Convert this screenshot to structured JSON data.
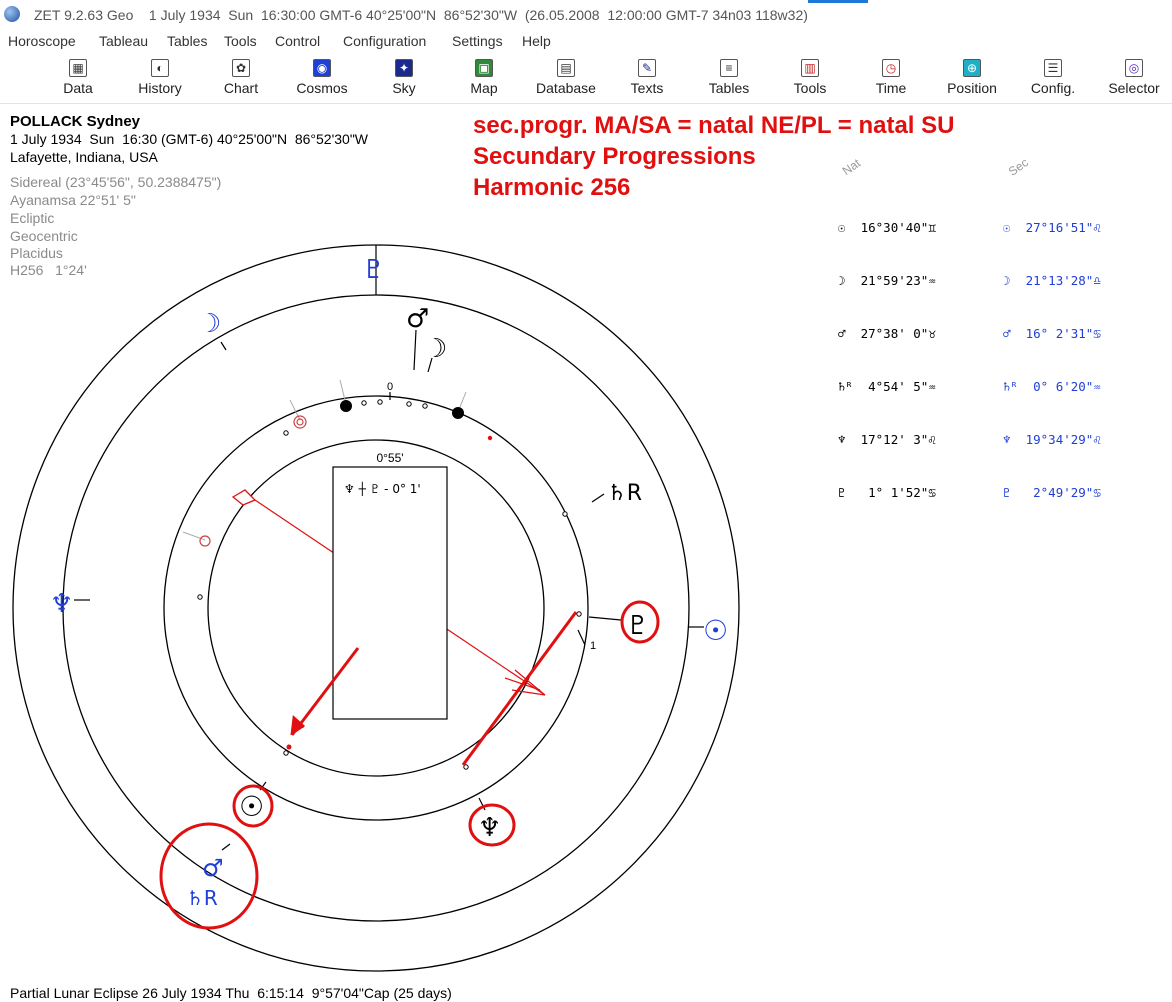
{
  "window": {
    "title": "ZET 9.2.63 Geo    1 July 1934  Sun  16:30:00 GMT-6 40°25'00\"N  86°52'30\"W  (26.05.2008  12:00:00 GMT-7 34n03 118w32)"
  },
  "menu": [
    "Horoscope",
    "Tableau",
    "Tables",
    "Tools",
    "Control",
    "Configuration",
    "Settings",
    "Help"
  ],
  "toolbar": [
    {
      "label": "Data",
      "icon": "data-icon",
      "glyph": "▦"
    },
    {
      "label": "History",
      "icon": "history-icon",
      "glyph": "◐"
    },
    {
      "label": "Chart",
      "icon": "chart-icon",
      "glyph": "✿"
    },
    {
      "label": "Cosmos",
      "icon": "cosmos-icon",
      "glyph": "◉"
    },
    {
      "label": "Sky",
      "icon": "sky-icon",
      "glyph": "✦"
    },
    {
      "label": "Map",
      "icon": "map-icon",
      "glyph": "▣"
    },
    {
      "label": "Database",
      "icon": "database-icon",
      "glyph": "▤"
    },
    {
      "label": "Texts",
      "icon": "texts-icon",
      "glyph": "✎"
    },
    {
      "label": "Tables",
      "icon": "tables-icon",
      "glyph": "≡"
    },
    {
      "label": "Tools",
      "icon": "tools-icon",
      "glyph": "▥"
    },
    {
      "label": "Time",
      "icon": "time-icon",
      "glyph": "◷"
    },
    {
      "label": "Position",
      "icon": "position-icon",
      "glyph": "⊕"
    },
    {
      "label": "Config.",
      "icon": "config-icon",
      "glyph": "☰"
    },
    {
      "label": "Selector",
      "icon": "selector-icon",
      "glyph": "◎"
    }
  ],
  "person": {
    "name": "POLLACK Sydney",
    "datetime": "1 July 1934  Sun  16:30 (GMT-6) 40°25'00\"N  86°52'30\"W",
    "place": "Lafayette, Indiana, USA"
  },
  "settings": [
    "Sidereal (23°45'56\", 50.2388475\")",
    "Ayanamsa 22°51' 5\"",
    "Ecliptic",
    "Geocentric",
    "Placidus",
    "H256   1°24'"
  ],
  "headline": [
    "sec.progr. MA/SA = natal NE/PL = natal SU",
    "Secundary Progressions",
    "Harmonic 256"
  ],
  "positions": {
    "nat_header": "Nat",
    "sec_header": "Sec",
    "nat": [
      {
        "glyph": "☉",
        "pos": "16°30'40\"",
        "sign": "♊"
      },
      {
        "glyph": "☽",
        "pos": "21°59'23\"",
        "sign": "♒"
      },
      {
        "glyph": "♂",
        "pos": "27°38' 0\"",
        "sign": "♉"
      },
      {
        "glyph": "♄ᴿ",
        "pos": " 4°54' 5\"",
        "sign": "♒"
      },
      {
        "glyph": "♆",
        "pos": "17°12' 3\"",
        "sign": "♌"
      },
      {
        "glyph": "♇",
        "pos": " 1° 1'52\"",
        "sign": "♋"
      }
    ],
    "sec": [
      {
        "glyph": "☉",
        "pos": "27°16'51\"",
        "sign": "♌"
      },
      {
        "glyph": "☽",
        "pos": "21°13'28\"",
        "sign": "♎"
      },
      {
        "glyph": "♂",
        "pos": "16° 2'31\"",
        "sign": "♋"
      },
      {
        "glyph": "♄ᴿ",
        "pos": " 0° 6'20\"",
        "sign": "♒"
      },
      {
        "glyph": "♆",
        "pos": "19°34'29\"",
        "sign": "♌"
      },
      {
        "glyph": "♇",
        "pos": " 2°49'29\"",
        "sign": "♋"
      }
    ]
  },
  "wheel": {
    "box_label": "0°55'",
    "box_text": "♆ ┼ ♇ - 0° 1'",
    "tick_zero": "0",
    "tick_one": "1",
    "nat_glyphs": [
      "♂",
      "☽",
      "♄R",
      "♇",
      "♆",
      "☉"
    ],
    "sec_glyphs": [
      "♇",
      "☽",
      "♆",
      "☉",
      "♂",
      "♄R"
    ]
  },
  "footer": "Partial Lunar Eclipse 26 July 1934 Thu  6:15:14  9°57'04\"Cap (25 days)",
  "colors": {
    "headline": "#e01010",
    "sec": "#1f3fd6",
    "nat": "#000000",
    "arrow": "#e01010"
  }
}
